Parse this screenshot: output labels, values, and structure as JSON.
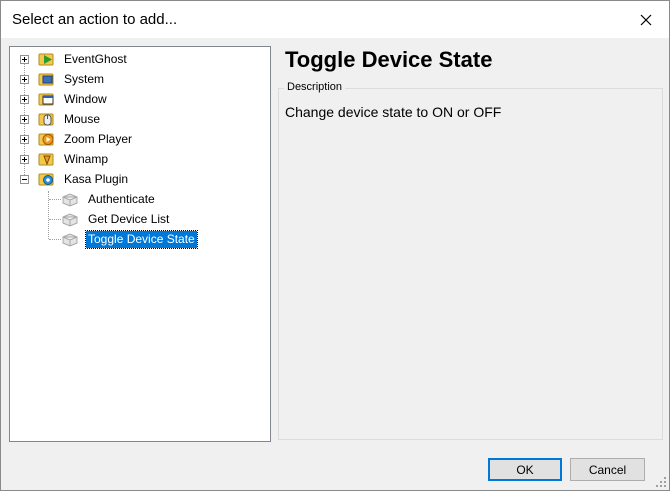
{
  "window": {
    "title": "Select an action to add..."
  },
  "tree": {
    "items": [
      {
        "label": "EventGhost",
        "icon": "eventghost-icon",
        "expander": "plus"
      },
      {
        "label": "System",
        "icon": "system-icon",
        "expander": "plus"
      },
      {
        "label": "Window",
        "icon": "window-icon",
        "expander": "plus"
      },
      {
        "label": "Mouse",
        "icon": "mouse-icon",
        "expander": "plus"
      },
      {
        "label": "Zoom Player",
        "icon": "zoomplayer-icon",
        "expander": "plus"
      },
      {
        "label": "Winamp",
        "icon": "winamp-icon",
        "expander": "plus"
      },
      {
        "label": "Kasa Plugin",
        "icon": "kasa-plugin-icon",
        "expander": "minus"
      }
    ],
    "children": [
      {
        "label": "Authenticate",
        "icon": "action-icon"
      },
      {
        "label": "Get Device List",
        "icon": "action-icon"
      },
      {
        "label": "Toggle Device State",
        "icon": "action-icon",
        "selected": true
      }
    ]
  },
  "detail": {
    "title": "Toggle Device State",
    "group_label": "Description",
    "description": "Change device state to ON or OFF"
  },
  "buttons": {
    "ok": "OK",
    "cancel": "Cancel"
  },
  "colors": {
    "selection": "#0078d7",
    "window_bg": "#f0f0f0"
  }
}
